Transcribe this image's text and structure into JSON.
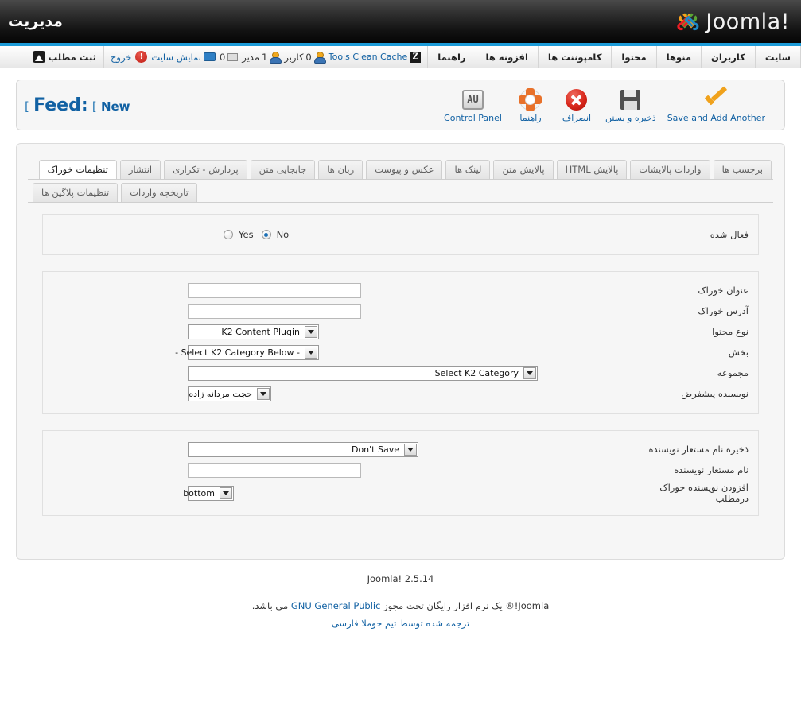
{
  "header": {
    "brand": "Joomla!",
    "admin_label": "مدیریت",
    "accent_color": "#1c9bd8"
  },
  "menubar": {
    "items": [
      {
        "label": "سایت"
      },
      {
        "label": "کاربران"
      },
      {
        "label": "منوها"
      },
      {
        "label": "محتوا"
      },
      {
        "label": "کامپوننت ها"
      },
      {
        "label": "افزونه ها"
      },
      {
        "label": "راهنما"
      }
    ],
    "status": {
      "zoo_label": "Tools Clean Cache",
      "zoo_badge": "Z",
      "users_count": "0",
      "users_label": "کاربر",
      "admin_count": "1",
      "admin_label": "مدیر",
      "messages_count": "0",
      "preview_label": "نمایش سایت",
      "alert_badge": "!",
      "logout_label": "خروج",
      "newpost_label": "ثبت مطلب"
    }
  },
  "toolbar": {
    "heading_bracket_open": "[",
    "heading_main": "Feed:",
    "heading_bracket_two": "[",
    "heading_sub": "New",
    "buttons": [
      {
        "label": "Save and Add Another",
        "icon": "checkmark-icon"
      },
      {
        "label": "ذخیره و بستن",
        "icon": "floppy-disk-icon"
      },
      {
        "label": "انصراف",
        "icon": "cancel-circle-icon"
      },
      {
        "label": "راهنما",
        "icon": "lifering-help-icon"
      },
      {
        "label": "Control Panel",
        "icon": "control-panel-icon"
      }
    ]
  },
  "tabs": {
    "row1": [
      {
        "label": "تنظیمات خوراک",
        "active": true
      },
      {
        "label": "انتشار",
        "active": false
      },
      {
        "label": "پردازش - تکراری",
        "active": false
      },
      {
        "label": "جابجایی متن",
        "active": false
      },
      {
        "label": "زبان ها",
        "active": false
      },
      {
        "label": "عکس و پیوست",
        "active": false
      },
      {
        "label": "لینک ها",
        "active": false
      },
      {
        "label": "پالایش متن",
        "active": false
      },
      {
        "label": "پالایش HTML",
        "active": false
      },
      {
        "label": "واردات پالایشات",
        "active": false
      },
      {
        "label": "برچسب ها",
        "active": false
      }
    ],
    "row2": [
      {
        "label": "تنظیمات پلاگین ها",
        "active": false
      },
      {
        "label": "تاریخچه واردات",
        "active": false
      }
    ]
  },
  "form": {
    "enabled": {
      "label": "فعال شده",
      "option_yes": "Yes",
      "option_no": "No",
      "selected": "No"
    },
    "fields": [
      {
        "label": "عنوان خوراک",
        "type": "text",
        "value": "",
        "placeholder": ""
      },
      {
        "label": "آدرس خوراک",
        "type": "text",
        "value": "",
        "placeholder": ""
      },
      {
        "label": "نوع محتوا",
        "type": "select",
        "value": "K2 Content Plugin"
      },
      {
        "label": "بخش",
        "type": "select",
        "value": "- Select K2 Category Below -"
      },
      {
        "label": "مجموعه",
        "type": "select",
        "value": "Select K2 Category"
      },
      {
        "label": "نویسنده پیشفرض",
        "type": "select",
        "value": "حجت مردانه زاده"
      }
    ],
    "author_fields": [
      {
        "label": "ذخیره نام مستعار نویسنده",
        "type": "select",
        "value": "Don't Save"
      },
      {
        "label": "نام مستعار نویسنده",
        "type": "text",
        "value": "",
        "placeholder": ""
      },
      {
        "label": "افزودن نویسنده خوراک درمطلب",
        "type": "select",
        "value": "bottom"
      }
    ]
  },
  "footer": {
    "version": "Joomla! 2.5.14",
    "license_prefix": "Joomla!®",
    "license_text_1": " یک نرم افزار رایگان تحت مجوز ",
    "license_link": "GNU General Public",
    "license_text_2": " می باشد.",
    "translation": "ترجمه شده توسط تیم جوملا فارسی"
  }
}
